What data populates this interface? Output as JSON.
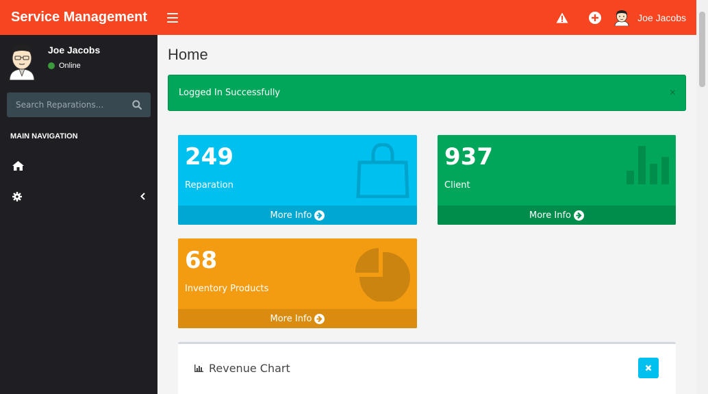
{
  "header": {
    "brand": "Service Management",
    "user_name": "Joe Jacobs"
  },
  "sidebar": {
    "user_name": "Joe Jacobs",
    "status": "Online",
    "search_placeholder": "Search Reparations...",
    "nav_header": "MAIN NAVIGATION",
    "items": [
      {
        "icon": "home-icon"
      },
      {
        "icon": "gear-icon"
      }
    ]
  },
  "main": {
    "page_title": "Home",
    "alert": {
      "text": "Logged In Successfully",
      "close": "×"
    },
    "boxes": [
      {
        "value": "249",
        "label": "Reparation",
        "footer": "More Info",
        "icon": "shopping-bag-icon",
        "color": "#00c0ef",
        "footer_color": "#00a7d0"
      },
      {
        "value": "937",
        "label": "Client",
        "footer": "More Info",
        "icon": "bar-chart-icon",
        "color": "#00a65a",
        "footer_color": "#008d4c"
      },
      {
        "value": "68",
        "label": "Inventory Products",
        "footer": "More Info",
        "icon": "pie-chart-icon",
        "color": "#f39c12",
        "footer_color": "#da8c10"
      }
    ],
    "panel": {
      "title": "Revenue Chart"
    }
  },
  "colors": {
    "topbar": "#f64520",
    "sidebar": "#1f1f23",
    "alert": "#00a65a"
  }
}
